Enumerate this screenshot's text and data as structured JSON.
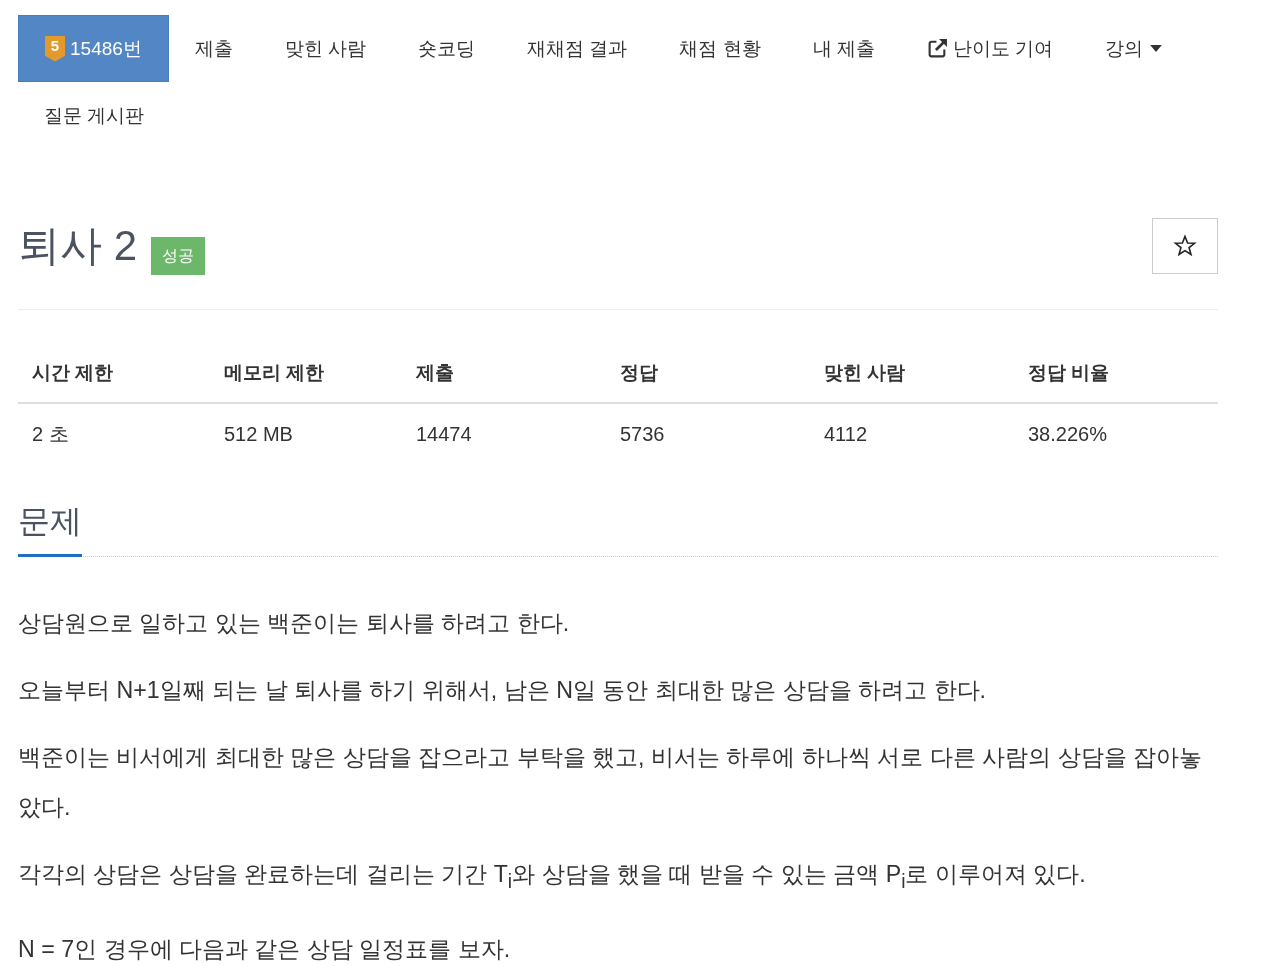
{
  "nav": {
    "items": [
      {
        "kind": "problem",
        "tier": "5",
        "label": "15486번",
        "selected": true
      },
      {
        "kind": "link",
        "label": "제출",
        "selected": false
      },
      {
        "kind": "link",
        "label": "맞힌 사람",
        "selected": false
      },
      {
        "kind": "link",
        "label": "숏코딩",
        "selected": false
      },
      {
        "kind": "link",
        "label": "재채점 결과",
        "selected": false
      },
      {
        "kind": "link",
        "label": "채점 현황",
        "selected": false
      },
      {
        "kind": "link",
        "label": "내 제출",
        "selected": false
      },
      {
        "kind": "external",
        "label": "난이도 기여",
        "selected": false
      },
      {
        "kind": "dropdown",
        "label": "강의",
        "selected": false
      },
      {
        "kind": "link",
        "label": "질문 게시판",
        "selected": false
      }
    ]
  },
  "problem": {
    "title": "퇴사 2",
    "status": "성공",
    "starred": false
  },
  "stats": {
    "columns": [
      "시간 제한",
      "메모리 제한",
      "제출",
      "정답",
      "맞힌 사람",
      "정답 비율"
    ],
    "rows": [
      [
        "2 초",
        "512 MB",
        "14474",
        "5736",
        "4112",
        "38.226%"
      ]
    ]
  },
  "section": {
    "heading": "문제",
    "paragraphs": [
      "상담원으로 일하고 있는 백준이는 퇴사를 하려고 한다.",
      "오늘부터 N+1일째 되는 날 퇴사를 하기 위해서, 남은 N일 동안 최대한 많은 상담을 하려고 한다.",
      "백준이는 비서에게 최대한 많은 상담을 잡으라고 부탁을 했고, 비서는 하루에 하나씩 서로 다른 사람의 상담을 잡아놓았다.",
      "각각의 상담은 상담을 완료하는데 걸리는 기간 T$_{i}$와 상담을 했을 때 받을 수 있는 금액 P$_{i}$로 이루어져 있다.",
      "N = 7인 경우에 다음과 같은 상담 일정표를 보자."
    ]
  }
}
